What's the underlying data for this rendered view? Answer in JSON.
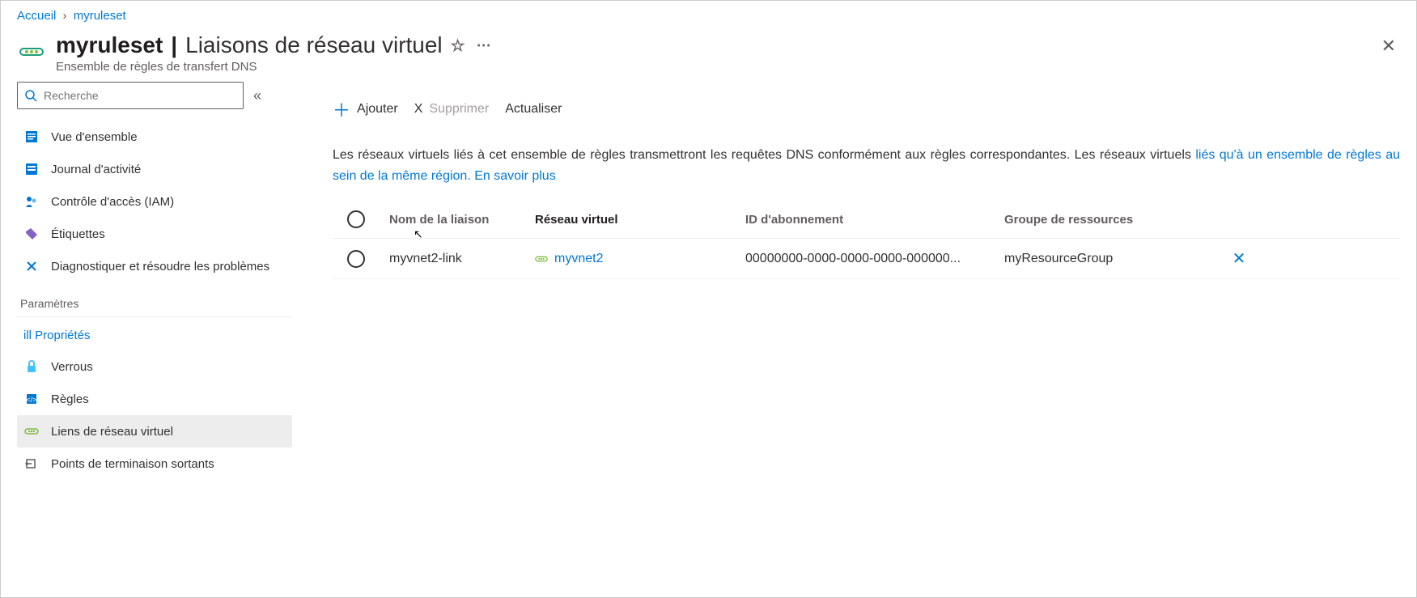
{
  "breadcrumb": {
    "home": "Accueil",
    "current": "myruleset"
  },
  "header": {
    "resource_name": "myruleset",
    "page_title": "Liaisons de réseau virtuel",
    "subtitle": "Ensemble de règles de transfert DNS"
  },
  "sidebar": {
    "search_placeholder": "Recherche",
    "items": {
      "overview": "Vue d'ensemble",
      "activity": "Journal d'activité",
      "iam": "Contrôle d'accès (IAM)",
      "tags": "Étiquettes",
      "diagnose": "Diagnostiquer et résoudre les problèmes"
    },
    "section_settings": "Paramètres",
    "settings": {
      "properties": "ill Propriétés",
      "locks": "Verrous",
      "rules": "Règles",
      "vnet_links": "Liens de réseau virtuel",
      "outbound": "Points de terminaison sortants"
    }
  },
  "toolbar": {
    "add": "Ajouter",
    "delete_x": "X",
    "delete": "Supprimer",
    "refresh": "Actualiser"
  },
  "info": {
    "text_a": "Les réseaux virtuels liés à cet ensemble de règles transmettront les requêtes DNS conformément aux règles correspondantes. Les réseaux virtuels ",
    "text_b": "liés qu'à un ensemble de règles au sein de la même région. En savoir plus"
  },
  "table": {
    "headers": {
      "link_name": "Nom de la liaison",
      "vnet": "Réseau virtuel",
      "sub_id": "ID d'abonnement",
      "rg": "Groupe de ressources"
    },
    "rows": [
      {
        "link_name": "myvnet2-link",
        "vnet": "myvnet2",
        "sub_id": "00000000-0000-0000-0000-000000...",
        "rg": "myResourceGroup"
      }
    ]
  }
}
